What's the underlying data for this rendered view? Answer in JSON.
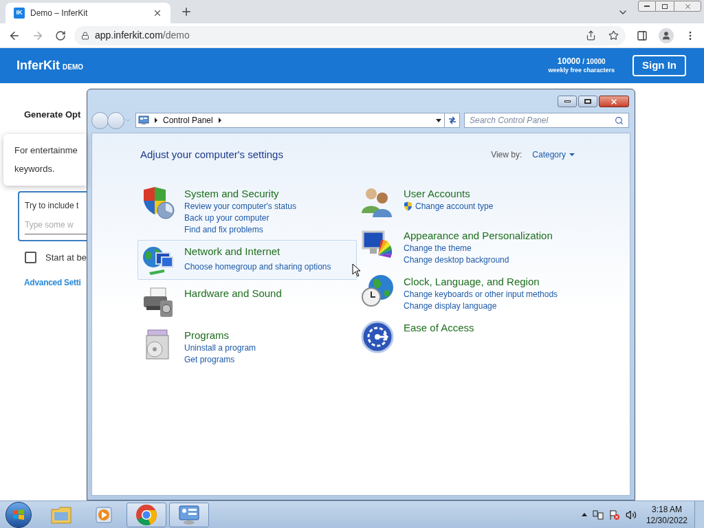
{
  "browser": {
    "tabs": [
      {
        "icon_text": "IK",
        "title": "Demo – InferKit",
        "selected": true
      }
    ],
    "address": {
      "host": "app.inferkit.com",
      "path": "/demo"
    }
  },
  "site_header": {
    "logo": "InferKit",
    "logo_badge": "DEMO",
    "quota_used": "10000",
    "quota_total": "/ 10000",
    "quota_caption": "weekly free characters",
    "sign_in": "Sign In"
  },
  "page": {
    "heading": "Generate Opt",
    "tooltip_lines": [
      "For entertainme",
      "keywords."
    ],
    "keywords_field": {
      "label": "Try to include t",
      "placeholder": "Type some w"
    },
    "checkbox": {
      "label": "Start at be",
      "checked": false
    },
    "advanced_link": "Advanced Setti"
  },
  "control_panel": {
    "breadcrumb": [
      "Control Panel"
    ],
    "search_placeholder": "Search Control Panel",
    "heading": "Adjust your computer's settings",
    "view_by_label": "View by:",
    "view_by_value": "Category",
    "columns": [
      [
        {
          "title": "System and Security",
          "hovered": false,
          "links": [
            {
              "text": "Review your computer's status",
              "shield": false
            },
            {
              "text": "Back up your computer",
              "shield": false
            },
            {
              "text": "Find and fix problems",
              "shield": false
            }
          ]
        },
        {
          "title": "Network and Internet",
          "hovered": true,
          "links": [
            {
              "text": "Choose homegroup and sharing options",
              "shield": false
            }
          ]
        },
        {
          "title": "Hardware and Sound",
          "hovered": false
        },
        {
          "title": "Programs",
          "hovered": false,
          "links": [
            {
              "text": "Uninstall a program",
              "shield": false
            },
            {
              "text": "Get programs",
              "shield": false
            }
          ]
        }
      ],
      [
        {
          "title": "User Accounts",
          "hovered": false,
          "links": [
            {
              "text": "Change account type",
              "shield": true
            }
          ]
        },
        {
          "title": "Appearance and Personalization",
          "hovered": false,
          "links": [
            {
              "text": "Change the theme",
              "shield": false
            },
            {
              "text": "Change desktop background",
              "shield": false
            }
          ]
        },
        {
          "title": "Clock, Language, and Region",
          "hovered": false,
          "links": [
            {
              "text": "Change keyboards or other input methods",
              "shield": false
            },
            {
              "text": "Change display language",
              "shield": false
            }
          ]
        },
        {
          "title": "Ease of Access",
          "hovered": false
        }
      ]
    ]
  },
  "taskbar": {
    "items": [
      {
        "selected": false
      },
      {
        "selected": false
      },
      {
        "selected": true
      },
      {
        "selected": true
      }
    ],
    "clock": {
      "time": "3:18 AM",
      "date": "12/30/2022"
    }
  }
}
